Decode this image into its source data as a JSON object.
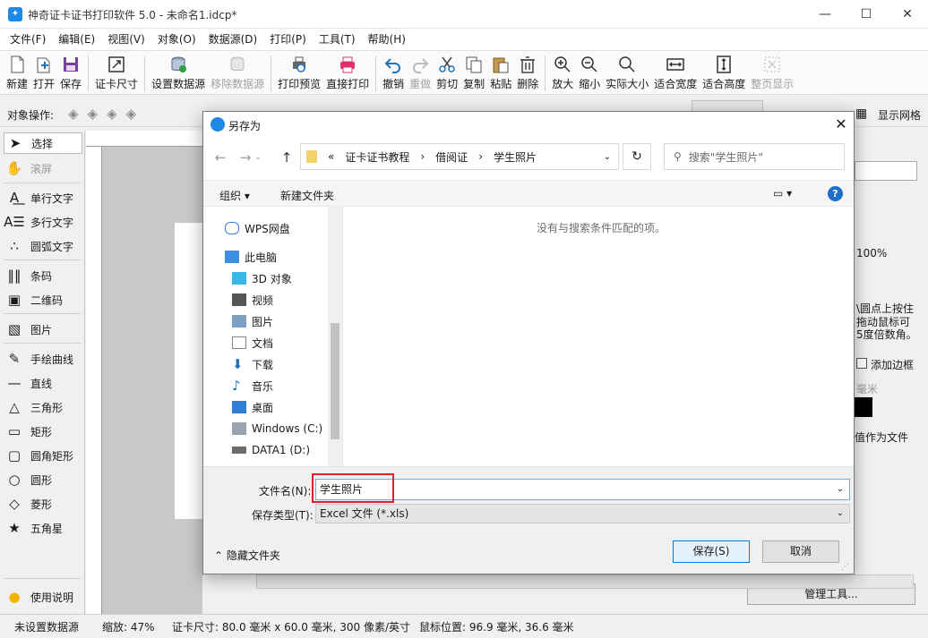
{
  "window": {
    "title": "神奇证卡证书打印软件 5.0 - 未命名1.idcp*"
  },
  "menu": [
    "文件(F)",
    "编辑(E)",
    "视图(V)",
    "对象(O)",
    "数据源(D)",
    "打印(P)",
    "工具(T)",
    "帮助(H)"
  ],
  "toolbar": [
    {
      "label": "新建",
      "icon": "new-file-icon"
    },
    {
      "label": "打开",
      "icon": "open-icon"
    },
    {
      "label": "保存",
      "icon": "save-icon"
    },
    {
      "label": "证卡尺寸",
      "icon": "card-size-icon"
    },
    {
      "label": "设置数据源",
      "icon": "datasource-icon"
    },
    {
      "label": "移除数据源",
      "icon": "remove-datasource-icon",
      "disabled": true
    },
    {
      "label": "打印预览",
      "icon": "print-preview-icon"
    },
    {
      "label": "直接打印",
      "icon": "print-icon"
    },
    {
      "label": "撤销",
      "icon": "undo-icon"
    },
    {
      "label": "重做",
      "icon": "redo-icon",
      "disabled": true
    },
    {
      "label": "剪切",
      "icon": "cut-icon"
    },
    {
      "label": "复制",
      "icon": "copy-icon"
    },
    {
      "label": "粘贴",
      "icon": "paste-icon"
    },
    {
      "label": "删除",
      "icon": "delete-icon"
    },
    {
      "label": "放大",
      "icon": "zoom-in-icon"
    },
    {
      "label": "缩小",
      "icon": "zoom-out-icon"
    },
    {
      "label": "实际大小",
      "icon": "actual-size-icon"
    },
    {
      "label": "适合宽度",
      "icon": "fit-width-icon"
    },
    {
      "label": "适合高度",
      "icon": "fit-height-icon"
    },
    {
      "label": "整页显示",
      "icon": "fit-page-icon",
      "disabled": true
    }
  ],
  "objrow": {
    "label": "对象操作:",
    "grid_label": "显示网格"
  },
  "tools": [
    "选择",
    "滚屏",
    "单行文字",
    "多行文字",
    "圆弧文字",
    "条码",
    "二维码",
    "图片",
    "手绘曲线",
    "直线",
    "三角形",
    "矩形",
    "圆角矩形",
    "圆形",
    "菱形",
    "五角星",
    "使用说明"
  ],
  "right_panel": {
    "zoom": "100%",
    "hint1": "\\圆点上按住",
    "hint2": "拖动鼠标可",
    "hint3": "5度倍数角。",
    "add_border": "添加边框",
    "unit": "毫米",
    "save_as_file": "值作为文件",
    "manage_tools": "管理工具..."
  },
  "dialog": {
    "title": "另存为",
    "path": [
      "证卡证书教程",
      "借阅证",
      "学生照片"
    ],
    "search_placeholder": "搜索\"学生照片\"",
    "organize": "组织",
    "new_folder": "新建文件夹",
    "nav": [
      "WPS网盘",
      "此电脑",
      "3D 对象",
      "视频",
      "图片",
      "文档",
      "下载",
      "音乐",
      "桌面",
      "Windows (C:)",
      "DATA1 (D:)"
    ],
    "empty_message": "没有与搜索条件匹配的项。",
    "filename_label": "文件名(N):",
    "filename_value": "学生照片",
    "filetype_label": "保存类型(T):",
    "filetype_value": "Excel 文件 (*.xls)",
    "hide_folders": "隐藏文件夹",
    "save": "保存(S)",
    "cancel": "取消"
  },
  "status": {
    "datasource": "未设置数据源",
    "zoom": "缩放: 47%",
    "card_size": "证卡尺寸: 80.0 毫米 x 60.0 毫米, 300 像素/英寸",
    "mouse_pos": "鼠标位置: 96.9 毫米, 36.6 毫米"
  }
}
